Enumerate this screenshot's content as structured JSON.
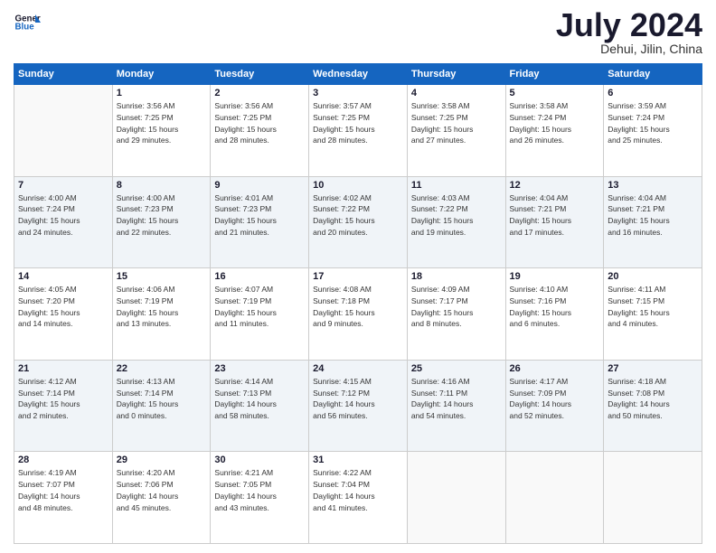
{
  "header": {
    "logo_line1": "General",
    "logo_line2": "Blue",
    "month_year": "July 2024",
    "location": "Dehui, Jilin, China"
  },
  "weekdays": [
    "Sunday",
    "Monday",
    "Tuesday",
    "Wednesday",
    "Thursday",
    "Friday",
    "Saturday"
  ],
  "weeks": [
    [
      {
        "day": "",
        "info": ""
      },
      {
        "day": "1",
        "info": "Sunrise: 3:56 AM\nSunset: 7:25 PM\nDaylight: 15 hours\nand 29 minutes."
      },
      {
        "day": "2",
        "info": "Sunrise: 3:56 AM\nSunset: 7:25 PM\nDaylight: 15 hours\nand 28 minutes."
      },
      {
        "day": "3",
        "info": "Sunrise: 3:57 AM\nSunset: 7:25 PM\nDaylight: 15 hours\nand 28 minutes."
      },
      {
        "day": "4",
        "info": "Sunrise: 3:58 AM\nSunset: 7:25 PM\nDaylight: 15 hours\nand 27 minutes."
      },
      {
        "day": "5",
        "info": "Sunrise: 3:58 AM\nSunset: 7:24 PM\nDaylight: 15 hours\nand 26 minutes."
      },
      {
        "day": "6",
        "info": "Sunrise: 3:59 AM\nSunset: 7:24 PM\nDaylight: 15 hours\nand 25 minutes."
      }
    ],
    [
      {
        "day": "7",
        "info": "Sunrise: 4:00 AM\nSunset: 7:24 PM\nDaylight: 15 hours\nand 24 minutes."
      },
      {
        "day": "8",
        "info": "Sunrise: 4:00 AM\nSunset: 7:23 PM\nDaylight: 15 hours\nand 22 minutes."
      },
      {
        "day": "9",
        "info": "Sunrise: 4:01 AM\nSunset: 7:23 PM\nDaylight: 15 hours\nand 21 minutes."
      },
      {
        "day": "10",
        "info": "Sunrise: 4:02 AM\nSunset: 7:22 PM\nDaylight: 15 hours\nand 20 minutes."
      },
      {
        "day": "11",
        "info": "Sunrise: 4:03 AM\nSunset: 7:22 PM\nDaylight: 15 hours\nand 19 minutes."
      },
      {
        "day": "12",
        "info": "Sunrise: 4:04 AM\nSunset: 7:21 PM\nDaylight: 15 hours\nand 17 minutes."
      },
      {
        "day": "13",
        "info": "Sunrise: 4:04 AM\nSunset: 7:21 PM\nDaylight: 15 hours\nand 16 minutes."
      }
    ],
    [
      {
        "day": "14",
        "info": "Sunrise: 4:05 AM\nSunset: 7:20 PM\nDaylight: 15 hours\nand 14 minutes."
      },
      {
        "day": "15",
        "info": "Sunrise: 4:06 AM\nSunset: 7:19 PM\nDaylight: 15 hours\nand 13 minutes."
      },
      {
        "day": "16",
        "info": "Sunrise: 4:07 AM\nSunset: 7:19 PM\nDaylight: 15 hours\nand 11 minutes."
      },
      {
        "day": "17",
        "info": "Sunrise: 4:08 AM\nSunset: 7:18 PM\nDaylight: 15 hours\nand 9 minutes."
      },
      {
        "day": "18",
        "info": "Sunrise: 4:09 AM\nSunset: 7:17 PM\nDaylight: 15 hours\nand 8 minutes."
      },
      {
        "day": "19",
        "info": "Sunrise: 4:10 AM\nSunset: 7:16 PM\nDaylight: 15 hours\nand 6 minutes."
      },
      {
        "day": "20",
        "info": "Sunrise: 4:11 AM\nSunset: 7:15 PM\nDaylight: 15 hours\nand 4 minutes."
      }
    ],
    [
      {
        "day": "21",
        "info": "Sunrise: 4:12 AM\nSunset: 7:14 PM\nDaylight: 15 hours\nand 2 minutes."
      },
      {
        "day": "22",
        "info": "Sunrise: 4:13 AM\nSunset: 7:14 PM\nDaylight: 15 hours\nand 0 minutes."
      },
      {
        "day": "23",
        "info": "Sunrise: 4:14 AM\nSunset: 7:13 PM\nDaylight: 14 hours\nand 58 minutes."
      },
      {
        "day": "24",
        "info": "Sunrise: 4:15 AM\nSunset: 7:12 PM\nDaylight: 14 hours\nand 56 minutes."
      },
      {
        "day": "25",
        "info": "Sunrise: 4:16 AM\nSunset: 7:11 PM\nDaylight: 14 hours\nand 54 minutes."
      },
      {
        "day": "26",
        "info": "Sunrise: 4:17 AM\nSunset: 7:09 PM\nDaylight: 14 hours\nand 52 minutes."
      },
      {
        "day": "27",
        "info": "Sunrise: 4:18 AM\nSunset: 7:08 PM\nDaylight: 14 hours\nand 50 minutes."
      }
    ],
    [
      {
        "day": "28",
        "info": "Sunrise: 4:19 AM\nSunset: 7:07 PM\nDaylight: 14 hours\nand 48 minutes."
      },
      {
        "day": "29",
        "info": "Sunrise: 4:20 AM\nSunset: 7:06 PM\nDaylight: 14 hours\nand 45 minutes."
      },
      {
        "day": "30",
        "info": "Sunrise: 4:21 AM\nSunset: 7:05 PM\nDaylight: 14 hours\nand 43 minutes."
      },
      {
        "day": "31",
        "info": "Sunrise: 4:22 AM\nSunset: 7:04 PM\nDaylight: 14 hours\nand 41 minutes."
      },
      {
        "day": "",
        "info": ""
      },
      {
        "day": "",
        "info": ""
      },
      {
        "day": "",
        "info": ""
      }
    ]
  ]
}
